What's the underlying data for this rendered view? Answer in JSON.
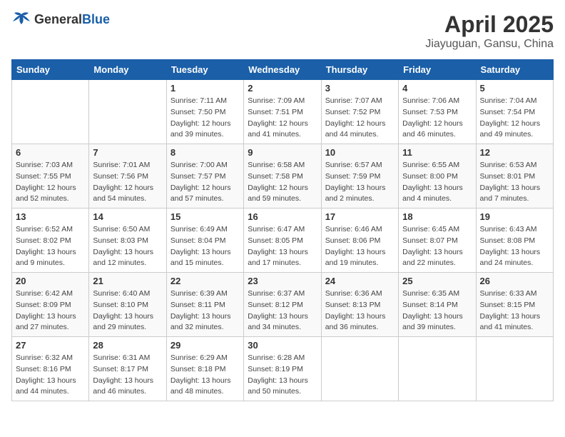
{
  "header": {
    "logo_general": "General",
    "logo_blue": "Blue",
    "month_title": "April 2025",
    "location": "Jiayuguan, Gansu, China"
  },
  "days_of_week": [
    "Sunday",
    "Monday",
    "Tuesday",
    "Wednesday",
    "Thursday",
    "Friday",
    "Saturday"
  ],
  "weeks": [
    [
      {
        "day": "",
        "info": ""
      },
      {
        "day": "",
        "info": ""
      },
      {
        "day": "1",
        "sunrise": "Sunrise: 7:11 AM",
        "sunset": "Sunset: 7:50 PM",
        "daylight": "Daylight: 12 hours and 39 minutes."
      },
      {
        "day": "2",
        "sunrise": "Sunrise: 7:09 AM",
        "sunset": "Sunset: 7:51 PM",
        "daylight": "Daylight: 12 hours and 41 minutes."
      },
      {
        "day": "3",
        "sunrise": "Sunrise: 7:07 AM",
        "sunset": "Sunset: 7:52 PM",
        "daylight": "Daylight: 12 hours and 44 minutes."
      },
      {
        "day": "4",
        "sunrise": "Sunrise: 7:06 AM",
        "sunset": "Sunset: 7:53 PM",
        "daylight": "Daylight: 12 hours and 46 minutes."
      },
      {
        "day": "5",
        "sunrise": "Sunrise: 7:04 AM",
        "sunset": "Sunset: 7:54 PM",
        "daylight": "Daylight: 12 hours and 49 minutes."
      }
    ],
    [
      {
        "day": "6",
        "sunrise": "Sunrise: 7:03 AM",
        "sunset": "Sunset: 7:55 PM",
        "daylight": "Daylight: 12 hours and 52 minutes."
      },
      {
        "day": "7",
        "sunrise": "Sunrise: 7:01 AM",
        "sunset": "Sunset: 7:56 PM",
        "daylight": "Daylight: 12 hours and 54 minutes."
      },
      {
        "day": "8",
        "sunrise": "Sunrise: 7:00 AM",
        "sunset": "Sunset: 7:57 PM",
        "daylight": "Daylight: 12 hours and 57 minutes."
      },
      {
        "day": "9",
        "sunrise": "Sunrise: 6:58 AM",
        "sunset": "Sunset: 7:58 PM",
        "daylight": "Daylight: 12 hours and 59 minutes."
      },
      {
        "day": "10",
        "sunrise": "Sunrise: 6:57 AM",
        "sunset": "Sunset: 7:59 PM",
        "daylight": "Daylight: 13 hours and 2 minutes."
      },
      {
        "day": "11",
        "sunrise": "Sunrise: 6:55 AM",
        "sunset": "Sunset: 8:00 PM",
        "daylight": "Daylight: 13 hours and 4 minutes."
      },
      {
        "day": "12",
        "sunrise": "Sunrise: 6:53 AM",
        "sunset": "Sunset: 8:01 PM",
        "daylight": "Daylight: 13 hours and 7 minutes."
      }
    ],
    [
      {
        "day": "13",
        "sunrise": "Sunrise: 6:52 AM",
        "sunset": "Sunset: 8:02 PM",
        "daylight": "Daylight: 13 hours and 9 minutes."
      },
      {
        "day": "14",
        "sunrise": "Sunrise: 6:50 AM",
        "sunset": "Sunset: 8:03 PM",
        "daylight": "Daylight: 13 hours and 12 minutes."
      },
      {
        "day": "15",
        "sunrise": "Sunrise: 6:49 AM",
        "sunset": "Sunset: 8:04 PM",
        "daylight": "Daylight: 13 hours and 15 minutes."
      },
      {
        "day": "16",
        "sunrise": "Sunrise: 6:47 AM",
        "sunset": "Sunset: 8:05 PM",
        "daylight": "Daylight: 13 hours and 17 minutes."
      },
      {
        "day": "17",
        "sunrise": "Sunrise: 6:46 AM",
        "sunset": "Sunset: 8:06 PM",
        "daylight": "Daylight: 13 hours and 19 minutes."
      },
      {
        "day": "18",
        "sunrise": "Sunrise: 6:45 AM",
        "sunset": "Sunset: 8:07 PM",
        "daylight": "Daylight: 13 hours and 22 minutes."
      },
      {
        "day": "19",
        "sunrise": "Sunrise: 6:43 AM",
        "sunset": "Sunset: 8:08 PM",
        "daylight": "Daylight: 13 hours and 24 minutes."
      }
    ],
    [
      {
        "day": "20",
        "sunrise": "Sunrise: 6:42 AM",
        "sunset": "Sunset: 8:09 PM",
        "daylight": "Daylight: 13 hours and 27 minutes."
      },
      {
        "day": "21",
        "sunrise": "Sunrise: 6:40 AM",
        "sunset": "Sunset: 8:10 PM",
        "daylight": "Daylight: 13 hours and 29 minutes."
      },
      {
        "day": "22",
        "sunrise": "Sunrise: 6:39 AM",
        "sunset": "Sunset: 8:11 PM",
        "daylight": "Daylight: 13 hours and 32 minutes."
      },
      {
        "day": "23",
        "sunrise": "Sunrise: 6:37 AM",
        "sunset": "Sunset: 8:12 PM",
        "daylight": "Daylight: 13 hours and 34 minutes."
      },
      {
        "day": "24",
        "sunrise": "Sunrise: 6:36 AM",
        "sunset": "Sunset: 8:13 PM",
        "daylight": "Daylight: 13 hours and 36 minutes."
      },
      {
        "day": "25",
        "sunrise": "Sunrise: 6:35 AM",
        "sunset": "Sunset: 8:14 PM",
        "daylight": "Daylight: 13 hours and 39 minutes."
      },
      {
        "day": "26",
        "sunrise": "Sunrise: 6:33 AM",
        "sunset": "Sunset: 8:15 PM",
        "daylight": "Daylight: 13 hours and 41 minutes."
      }
    ],
    [
      {
        "day": "27",
        "sunrise": "Sunrise: 6:32 AM",
        "sunset": "Sunset: 8:16 PM",
        "daylight": "Daylight: 13 hours and 44 minutes."
      },
      {
        "day": "28",
        "sunrise": "Sunrise: 6:31 AM",
        "sunset": "Sunset: 8:17 PM",
        "daylight": "Daylight: 13 hours and 46 minutes."
      },
      {
        "day": "29",
        "sunrise": "Sunrise: 6:29 AM",
        "sunset": "Sunset: 8:18 PM",
        "daylight": "Daylight: 13 hours and 48 minutes."
      },
      {
        "day": "30",
        "sunrise": "Sunrise: 6:28 AM",
        "sunset": "Sunset: 8:19 PM",
        "daylight": "Daylight: 13 hours and 50 minutes."
      },
      {
        "day": "",
        "info": ""
      },
      {
        "day": "",
        "info": ""
      },
      {
        "day": "",
        "info": ""
      }
    ]
  ]
}
